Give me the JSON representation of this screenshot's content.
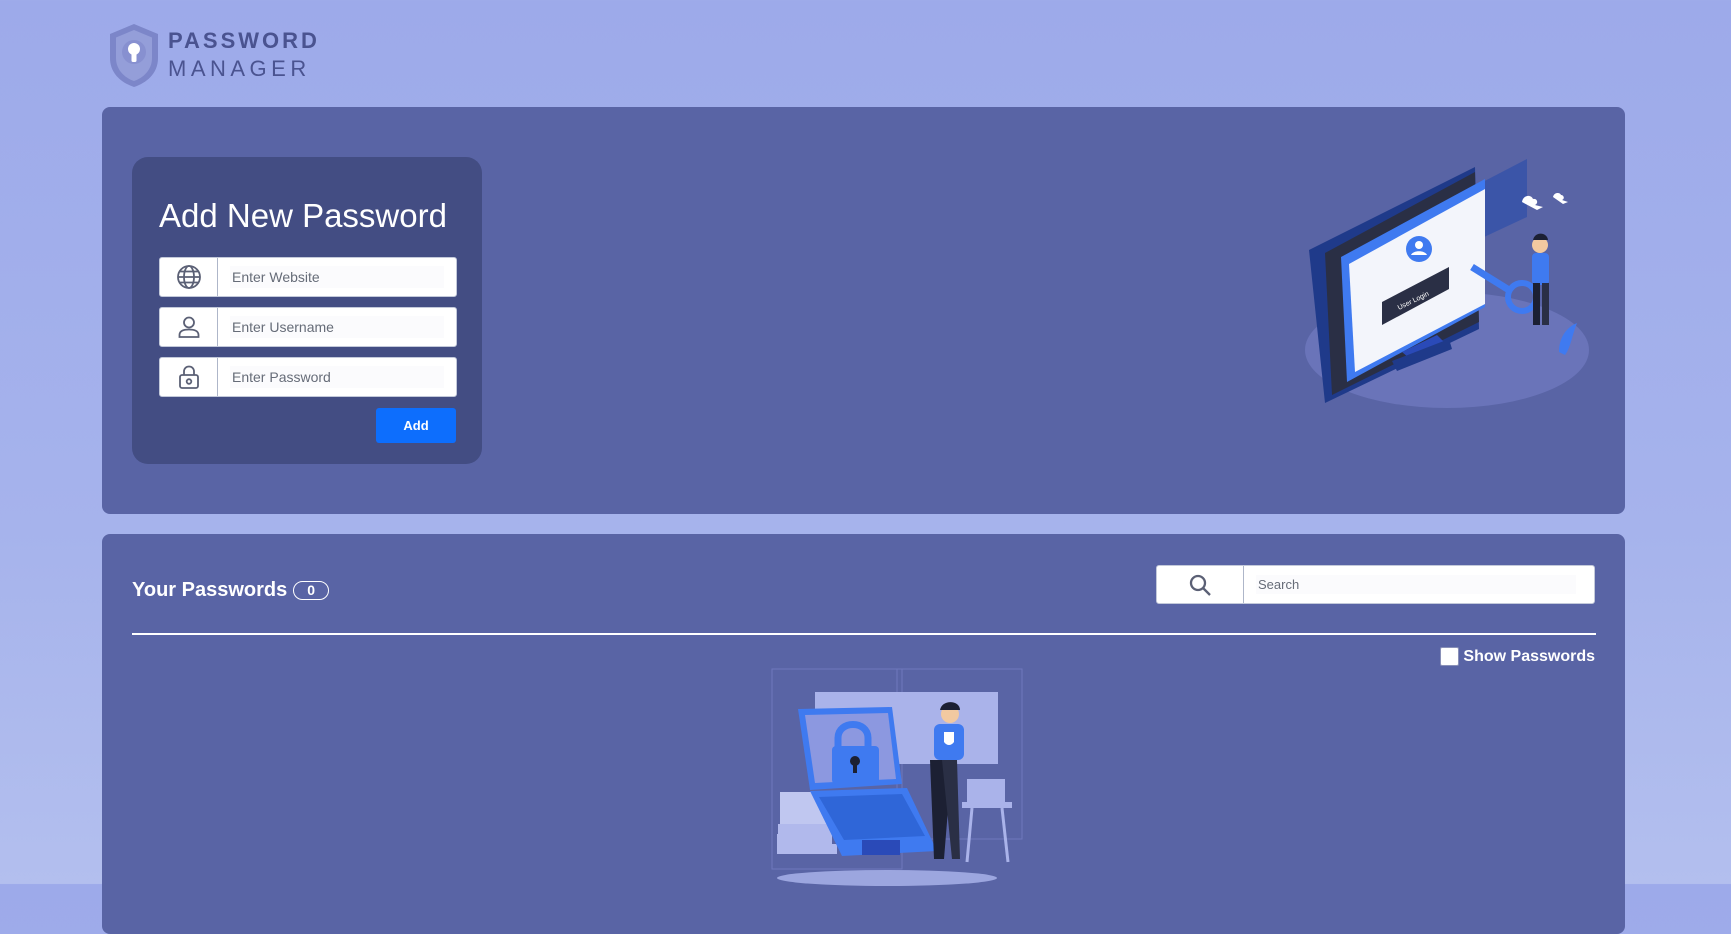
{
  "app": {
    "logo_line1": "PASSWORD",
    "logo_line2": "MANAGER",
    "logo_icon": "shield-keyhole-icon"
  },
  "add_form": {
    "title": "Add New Password",
    "website_placeholder": "Enter Website",
    "username_placeholder": "Enter Username",
    "password_placeholder": "Enter Password",
    "add_label": "Add",
    "icons": [
      "globe-icon",
      "user-icon",
      "lock-icon"
    ]
  },
  "passwords": {
    "title": "Your Passwords",
    "count": "0",
    "search_placeholder": "Search",
    "show_passwords_label": "Show Passwords",
    "show_passwords_checked": false
  },
  "illustrations": {
    "top_screen_text": "User Login"
  },
  "colors": {
    "page_bg": "#9daaea",
    "panel_bg": "#5964a5",
    "card_bg": "#434d83",
    "accent": "#0d6efd",
    "illustration_blue": "#3f7af0"
  }
}
